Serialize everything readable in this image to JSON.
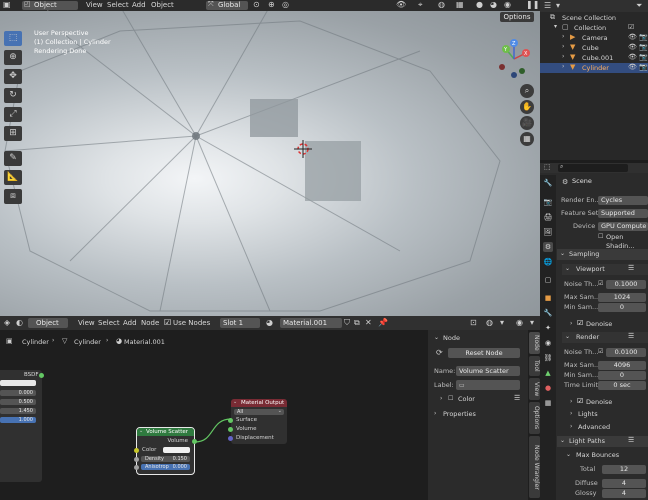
{
  "viewport_header": {
    "mode": "Object Mode",
    "menus": [
      "View",
      "Select",
      "Add",
      "Object"
    ],
    "orientation": "Global",
    "options_label": "Options"
  },
  "viewport": {
    "overlay_lines": [
      "User Perspective",
      "(1) Collection | Cylinder",
      "Rendering Done"
    ],
    "gizmo_axes": [
      "X",
      "Y",
      "Z"
    ]
  },
  "outliner": {
    "root": "Scene Collection",
    "items": [
      {
        "label": "Collection",
        "icon": "collection-icon",
        "selected": false,
        "indent": 1
      },
      {
        "label": "Camera",
        "icon": "camera-icon",
        "selected": false,
        "indent": 2
      },
      {
        "label": "Cube",
        "icon": "mesh-icon",
        "selected": false,
        "indent": 2
      },
      {
        "label": "Cube.001",
        "icon": "mesh-icon",
        "selected": false,
        "indent": 2
      },
      {
        "label": "Cylinder",
        "icon": "mesh-icon",
        "selected": true,
        "indent": 2
      }
    ]
  },
  "properties": {
    "context": "Scene",
    "render_engine_label": "Render En...",
    "render_engine": "Cycles",
    "feature_set_label": "Feature Set",
    "feature_set": "Supported",
    "device_label": "Device",
    "device": "GPU Compute",
    "open_shading_label": "Open Shadin...",
    "sampling": "Sampling",
    "viewport": "Viewport",
    "noise_label": "Noise Th...",
    "viewport_noise": "0.1000",
    "max_samples_label": "Max Sam...",
    "viewport_max_samples": "1024",
    "min_samples_label": "Min Sam...",
    "viewport_min_samples": "0",
    "denoise": "Denoise",
    "render": "Render",
    "render_noise": "0.0100",
    "render_max_samples": "4096",
    "render_min_samples": "0",
    "time_limit_label": "Time Limit",
    "time_limit": "0 sec",
    "lights": "Lights",
    "advanced": "Advanced",
    "light_paths": "Light Paths",
    "max_bounces": "Max Bounces",
    "total_label": "Total",
    "total": "12",
    "diffuse_label": "Diffuse",
    "diffuse": "4",
    "glossy_label": "Glossy",
    "glossy": "4"
  },
  "node_header": {
    "mode": "Object",
    "menus": [
      "View",
      "Select",
      "Add",
      "Node"
    ],
    "use_nodes": "Use Nodes",
    "slot": "Slot 1",
    "material": "Material.001"
  },
  "breadcrumb": [
    "Cylinder",
    "Cylinder",
    "Material.001"
  ],
  "nodes": {
    "bsdf_label": "BSDF",
    "bsdf_values": [
      "0.000",
      "0.500",
      "1.450",
      "1.000"
    ],
    "volume_scatter": {
      "title": "Volume Scatter",
      "output": "Volume",
      "color_label": "Color",
      "density_label": "Density",
      "density": "0.150",
      "anisotropy_label": "Anisotrop",
      "anisotropy": "0.000"
    },
    "material_output": {
      "title": "Material Output",
      "target": "All",
      "inputs": [
        "Surface",
        "Volume",
        "Displacement"
      ]
    }
  },
  "npanel": {
    "section": "Node",
    "reset_button": "Reset Node",
    "name_label": "Name:",
    "name_value": "Volume Scatter",
    "label_label": "Label:",
    "color_section": "Color",
    "properties_section": "Properties",
    "tabs": [
      "Node",
      "Tool",
      "View",
      "Options",
      "Node Wrangler"
    ]
  },
  "colors": {
    "accent": "#4772b3",
    "selected_row": "#334d80",
    "shader_socket": "#63c763",
    "value_socket": "#a1a1a1",
    "vector_socket": "#6363c7",
    "color_socket": "#c7c729",
    "output_node_header": "#792b34",
    "shader_node_header": "#2f7a3f"
  }
}
